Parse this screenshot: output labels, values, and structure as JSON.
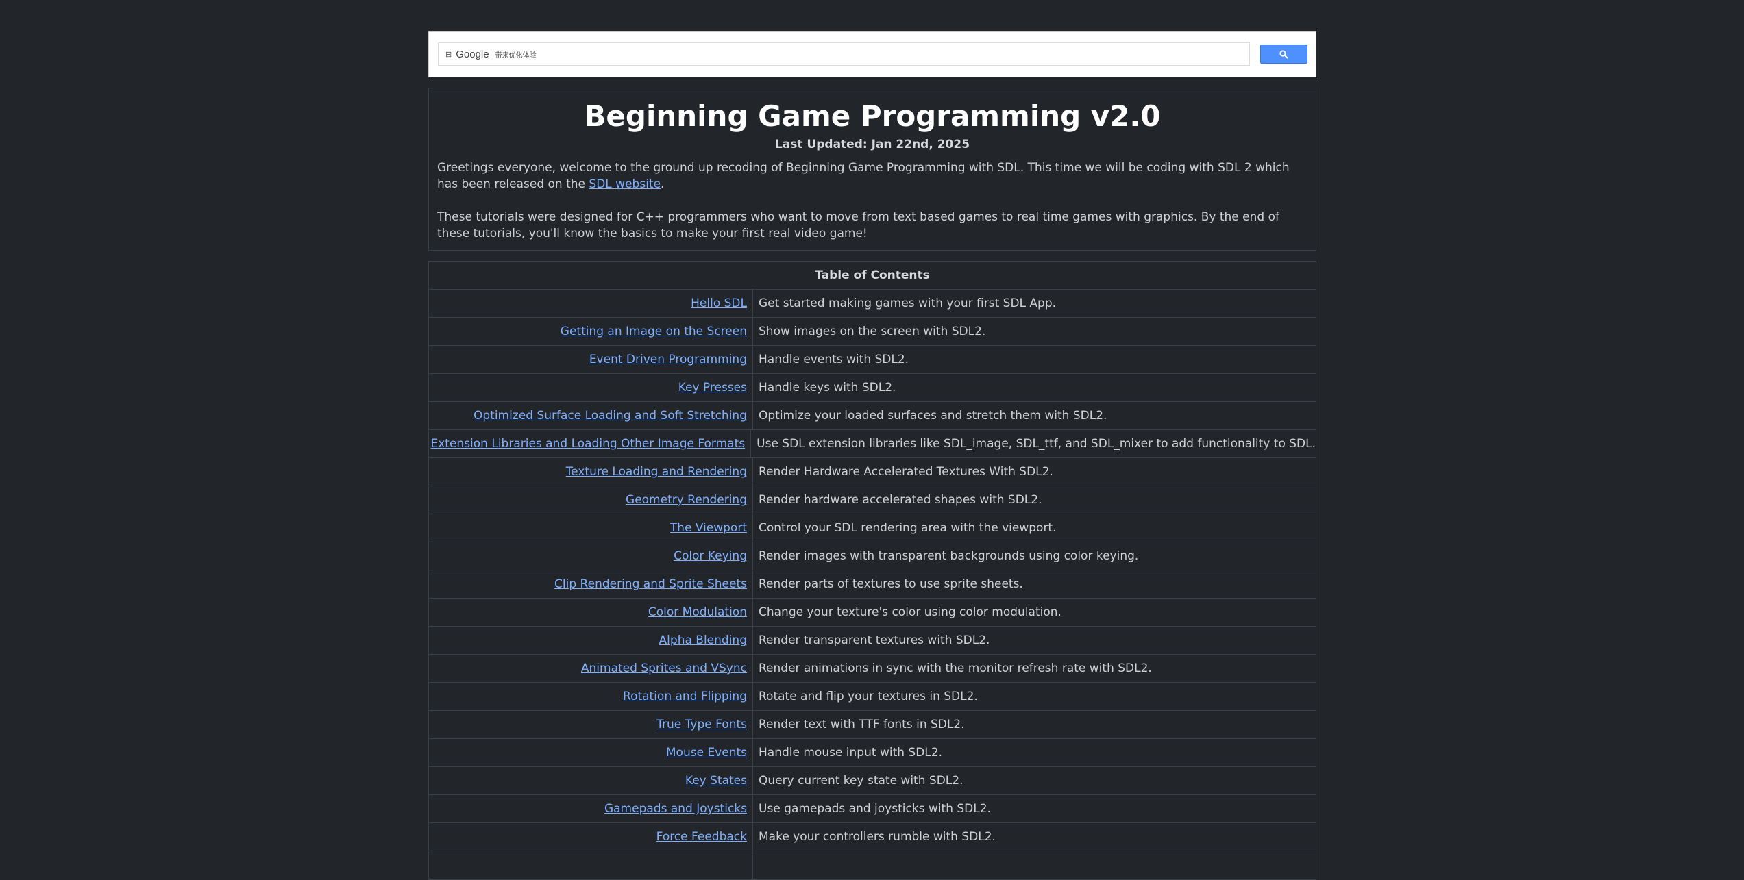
{
  "search": {
    "lock_glyph": "⊟",
    "brand": "Google",
    "hint": "带来优化体验",
    "button_icon": "search-icon",
    "button_color": "#4d90fe"
  },
  "header": {
    "title": "Beginning Game Programming v2.0",
    "updated": "Last Updated: Jan 22nd, 2025",
    "para1_text": "Greetings everyone, welcome to the ground up recoding of Beginning Game Programming with SDL. This time we will be coding with SDL 2 which has been released on the ",
    "para1_link": "SDL website",
    "para1_end": ".",
    "para2": "These tutorials were designed for C++ programmers who want to move from text based games to real time games with graphics. By the end of these tutorials, you'll know the basics to make your first real video game!"
  },
  "toc": {
    "title": "Table of Contents",
    "rows": [
      {
        "link": "Hello SDL",
        "desc": "Get started making games with your first SDL App."
      },
      {
        "link": "Getting an Image on the Screen",
        "desc": "Show images on the screen with SDL2."
      },
      {
        "link": "Event Driven Programming",
        "desc": "Handle events with SDL2."
      },
      {
        "link": "Key Presses",
        "desc": "Handle keys with SDL2."
      },
      {
        "link": "Optimized Surface Loading and Soft Stretching",
        "desc": "Optimize your loaded surfaces and stretch them with SDL2."
      },
      {
        "link": "Extension Libraries and Loading Other Image Formats",
        "desc": "Use SDL extension libraries like SDL_image, SDL_ttf, and SDL_mixer to add functionality to SDL."
      },
      {
        "link": "Texture Loading and Rendering",
        "desc": "Render Hardware Accelerated Textures With SDL2."
      },
      {
        "link": "Geometry Rendering",
        "desc": "Render hardware accelerated shapes with SDL2."
      },
      {
        "link": "The Viewport",
        "desc": "Control your SDL rendering area with the viewport."
      },
      {
        "link": "Color Keying",
        "desc": "Render images with transparent backgrounds using color keying."
      },
      {
        "link": "Clip Rendering and Sprite Sheets",
        "desc": "Render parts of textures to use sprite sheets."
      },
      {
        "link": "Color Modulation",
        "desc": "Change your texture's color using color modulation."
      },
      {
        "link": "Alpha Blending",
        "desc": "Render transparent textures with SDL2."
      },
      {
        "link": "Animated Sprites and VSync",
        "desc": "Render animations in sync with the monitor refresh rate with SDL2."
      },
      {
        "link": "Rotation and Flipping",
        "desc": "Rotate and flip your textures in SDL2."
      },
      {
        "link": "True Type Fonts",
        "desc": "Render text with TTF fonts in SDL2."
      },
      {
        "link": "Mouse Events",
        "desc": "Handle mouse input with SDL2."
      },
      {
        "link": "Key States",
        "desc": "Query current key state with SDL2."
      },
      {
        "link": "Gamepads and Joysticks",
        "desc": "Use gamepads and joysticks with SDL2."
      },
      {
        "link": "Force Feedback",
        "desc": "Make your controllers rumble with SDL2."
      },
      {
        "link": "",
        "desc": ""
      }
    ]
  },
  "colors": {
    "background": "#22252a",
    "link": "#7fb0ff",
    "border": "#3b4047"
  }
}
